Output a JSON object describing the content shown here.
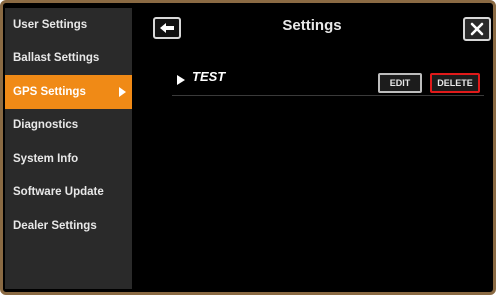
{
  "sidebar": {
    "items": [
      {
        "label": "User Settings"
      },
      {
        "label": "Ballast Settings"
      },
      {
        "label": "GPS Settings"
      },
      {
        "label": "Diagnostics"
      },
      {
        "label": "System Info"
      },
      {
        "label": "Software Update"
      },
      {
        "label": "Dealer Settings"
      }
    ],
    "active_index": 2
  },
  "header": {
    "title": "Settings",
    "back_icon": "back-arrow-icon",
    "close_icon": "close-icon"
  },
  "list": {
    "rows": [
      {
        "name": "TEST",
        "edit_label": "EDIT",
        "delete_label": "DELETE"
      }
    ]
  },
  "colors": {
    "accent": "#f08a16",
    "danger": "#e01a1a",
    "frame": "#8a6a43",
    "sidebar_bg": "#2a2a2a",
    "main_bg": "#000000"
  }
}
